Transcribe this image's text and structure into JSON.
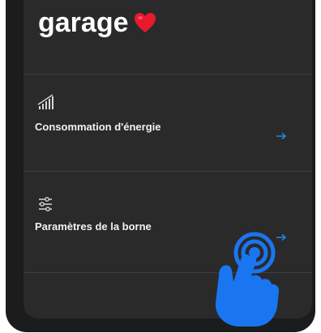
{
  "header": {
    "title": "garage",
    "emoji_icon": "red-heart-icon"
  },
  "menu": {
    "items": [
      {
        "label": "Consommation d'énergie",
        "icon": "signal-bars-icon",
        "action_icon": "arrow-right-icon"
      },
      {
        "label": "Paramètres de la borne",
        "icon": "sliders-icon",
        "action_icon": "arrow-right-icon"
      }
    ]
  },
  "overlay": {
    "icon": "tap-hand-icon"
  },
  "colors": {
    "background": "#2a2a2b",
    "text": "#ffffff",
    "arrow_accent": "#1e88e5",
    "hand": "#1976f0",
    "heart": "#e8192c"
  }
}
